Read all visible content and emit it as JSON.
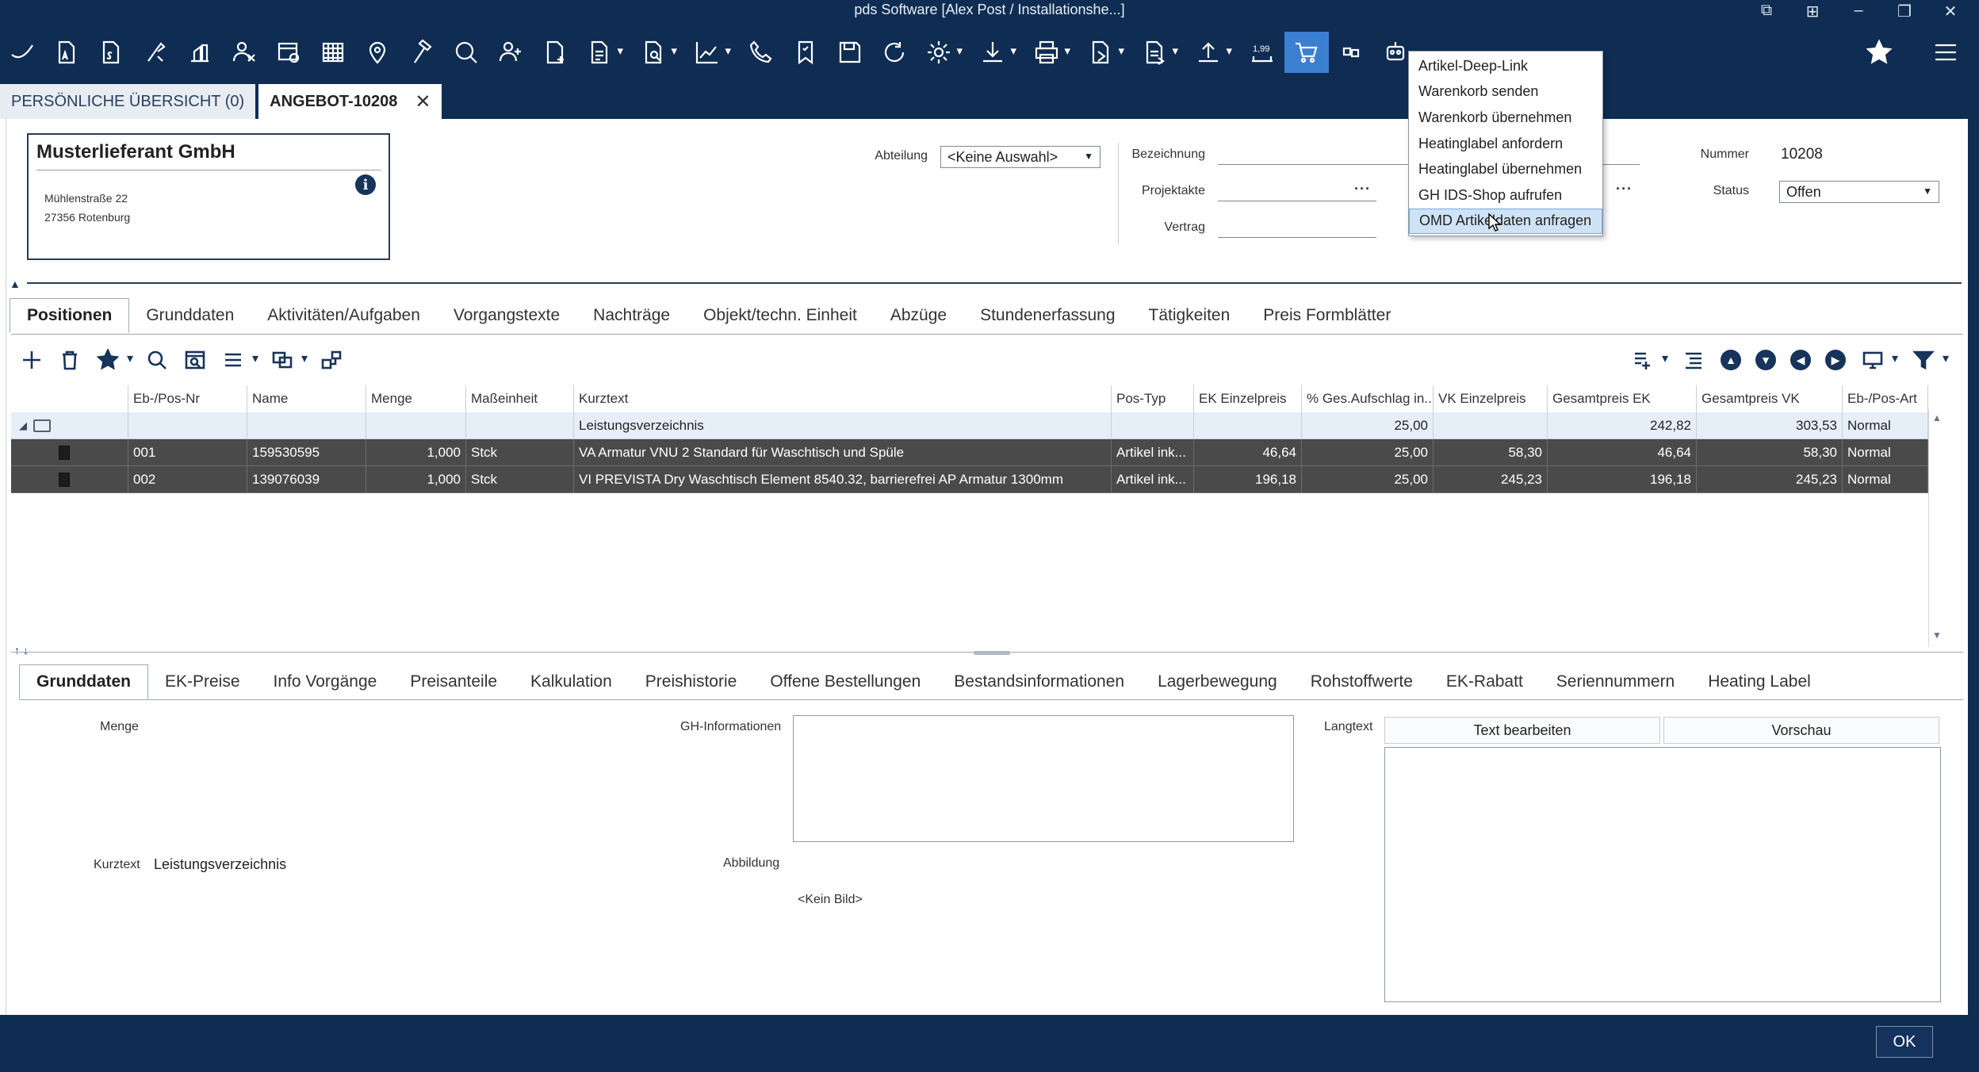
{
  "window": {
    "title": "pds Software [Alex Post / Installationshe...]"
  },
  "toolbar": {
    "quantity_badge": "1,99"
  },
  "doc_tabs": [
    {
      "label": "PERSÖNLICHE ÜBERSICHT (0)"
    },
    {
      "label": "ANGEBOT-10208"
    }
  ],
  "supplier": {
    "name": "Musterlieferant GmbH",
    "street": "Mühlenstraße 22",
    "city": "27356 Rotenburg"
  },
  "form": {
    "abteilung_label": "Abteilung",
    "abteilung_value": "<Keine Auswahl>",
    "bezeichnung_label": "Bezeichnung",
    "projektakte_label": "Projektakte",
    "vertrag_label": "Vertrag",
    "nummer_label": "Nummer",
    "nummer_value": "10208",
    "status_label": "Status",
    "status_value": "Offen",
    "dots": "···"
  },
  "main_tabs": [
    "Positionen",
    "Grunddaten",
    "Aktivitäten/Aufgaben",
    "Vorgangstexte",
    "Nachträge",
    "Objekt/techn. Einheit",
    "Abzüge",
    "Stundenerfassung",
    "Tätigkeiten",
    "Preis Formblätter"
  ],
  "grid": {
    "columns": [
      "",
      "Eb-/Pos-Nr",
      "Name",
      "Menge",
      "Maßeinheit",
      "Kurztext",
      "Pos-Typ",
      "EK Einzelpreis",
      "% Ges.Aufschlag in...",
      "VK Einzelpreis",
      "Gesamtpreis EK",
      "Gesamtpreis VK",
      "Eb-/Pos-Art"
    ],
    "group_row": [
      "",
      "",
      "",
      "",
      "",
      "Leistungsverzeichnis",
      "",
      "",
      "25,00",
      "",
      "242,82",
      "303,53",
      "Normal"
    ],
    "rows": [
      [
        "",
        "001",
        "159530595",
        "1,000",
        "Stck",
        "VA Armatur VNU 2 Standard für Waschtisch und Spüle",
        "Artikel ink...",
        "46,64",
        "25,00",
        "58,30",
        "46,64",
        "58,30",
        "Normal"
      ],
      [
        "",
        "002",
        "139076039",
        "1,000",
        "Stck",
        "VI PREVISTA Dry Waschtisch Element 8540.32, barrierefrei AP Armatur 1300mm",
        "Artikel ink...",
        "196,18",
        "25,00",
        "245,23",
        "196,18",
        "245,23",
        "Normal"
      ]
    ]
  },
  "detail_tabs": [
    "Grunddaten",
    "EK-Preise",
    "Info Vorgänge",
    "Preisanteile",
    "Kalkulation",
    "Preishistorie",
    "Offene Bestellungen",
    "Bestandsinformationen",
    "Lagerbewegung",
    "Rohstoffwerte",
    "EK-Rabatt",
    "Seriennummern",
    "Heating Label"
  ],
  "detail": {
    "menge_label": "Menge",
    "kurztext_label": "Kurztext",
    "kurztext_value": "Leistungsverzeichnis",
    "gh_info_label": "GH-Informationen",
    "abbildung_label": "Abbildung",
    "no_image": "<Kein Bild>",
    "langtext_label": "Langtext",
    "edit_text_button": "Text bearbeiten",
    "preview_button": "Vorschau"
  },
  "footer": {
    "ok_label": "OK"
  },
  "dropdown_menu": {
    "items": [
      "Artikel-Deep-Link",
      "Warenkorb senden",
      "Warenkorb übernehmen",
      "Heatinglabel anfordern",
      "Heatinglabel übernehmen",
      "GH IDS-Shop aufrufen",
      "OMD Artikeldaten anfragen"
    ],
    "hovered_index": 6
  },
  "colors": {
    "header_bg": "#0f2d52",
    "accent": "#3b7fd0",
    "selected_row": "#4a4a4a",
    "group_row": "#e6eff8"
  }
}
